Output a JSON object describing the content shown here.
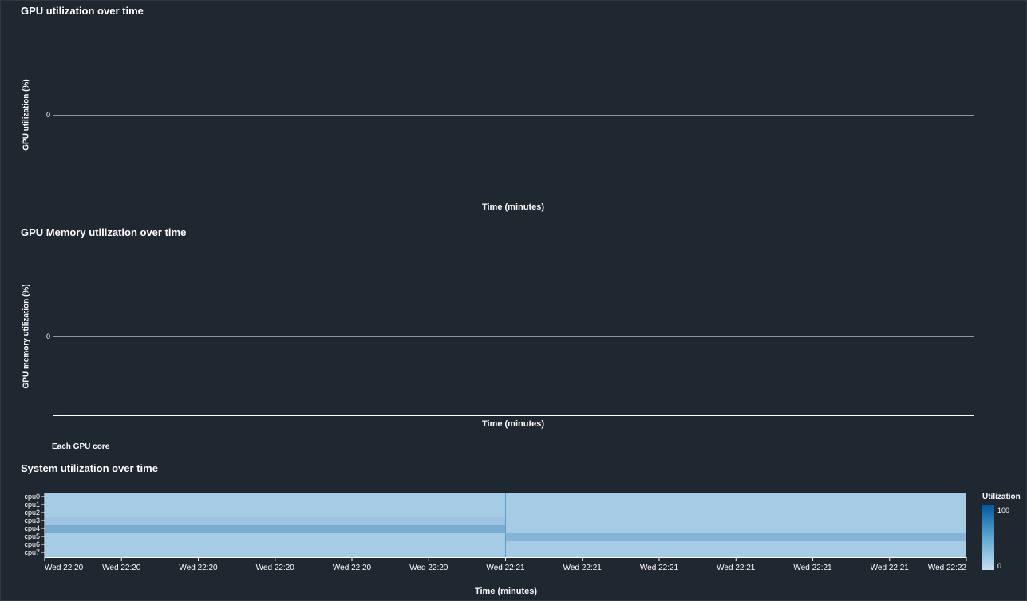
{
  "chart_data": [
    {
      "type": "line",
      "title": "GPU utilization over time",
      "ylabel": "GPU utilization (%)",
      "xlabel": "Time (minutes)",
      "y_ticks": [
        "0"
      ],
      "series": []
    },
    {
      "type": "line",
      "title": "GPU Memory utilization over time",
      "ylabel": "GPU memory utilization (%)",
      "xlabel": "Time (minutes)",
      "y_ticks": [
        "0"
      ],
      "series": []
    },
    {
      "type": "heatmap",
      "caption": "Each GPU core",
      "title": "System utilization over time",
      "xlabel": "Time (minutes)",
      "rows": [
        "cpu0",
        "cpu1",
        "cpu2",
        "cpu3",
        "cpu4",
        "cpu5",
        "cpu6",
        "cpu7"
      ],
      "x_ticks": [
        "Wed 22:20",
        "Wed 22:20",
        "Wed 22:20",
        "Wed 22:20",
        "Wed 22:20",
        "Wed 22:20",
        "Wed 22:21",
        "Wed 22:21",
        "Wed 22:21",
        "Wed 22:21",
        "Wed 22:21",
        "Wed 22:21",
        "Wed 22:22"
      ],
      "time_bins": [
        "Wed 22:20",
        "Wed 22:21"
      ],
      "values": [
        [
          15,
          15
        ],
        [
          15,
          15
        ],
        [
          15,
          15
        ],
        [
          20,
          15
        ],
        [
          38,
          15
        ],
        [
          15,
          32
        ],
        [
          15,
          15
        ],
        [
          15,
          15
        ]
      ],
      "legend": {
        "title": "Utilization",
        "min": "0",
        "max": "100",
        "min_value": 0,
        "max_value": 100
      },
      "colors": {
        "low": "#c3dff0",
        "high": "#045a9e"
      }
    }
  ]
}
